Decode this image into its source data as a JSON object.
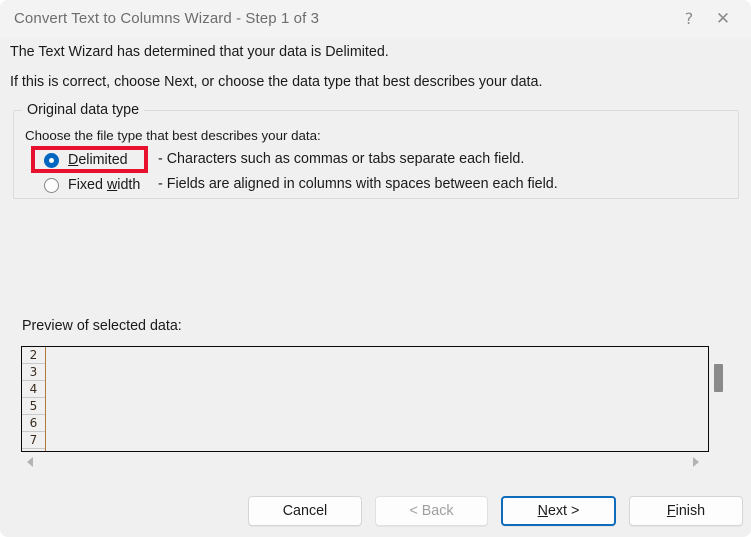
{
  "window": {
    "title": "Convert Text to Columns Wizard - Step 1 of 3",
    "help_glyph": "?",
    "close_glyph": "✕"
  },
  "intro": {
    "line1": "The Text Wizard has determined that your data is Delimited.",
    "line2": "If this is correct, choose Next, or choose the data type that best describes your data."
  },
  "original_data_type": {
    "legend": "Original data type",
    "instruction": "Choose the file type that best describes your data:",
    "options": [
      {
        "label_before": "",
        "accel": "D",
        "label_after": "elimited",
        "description": "- Characters such as commas or tabs separate each field.",
        "selected": true
      },
      {
        "label_before": "Fixed ",
        "accel": "w",
        "label_after": "idth",
        "description": "- Fields are aligned in columns with spaces between each field.",
        "selected": false
      }
    ],
    "highlight_color": "#e8112d"
  },
  "preview": {
    "label": "Preview of selected data:",
    "row_numbers": [
      "2",
      "3",
      "4",
      "5",
      "6",
      "7"
    ],
    "rows_content": [
      "",
      "",
      "",
      "",
      "",
      ""
    ],
    "hscroll_left_glyph": "left-arrow",
    "hscroll_right_glyph": "right-arrow"
  },
  "buttons": {
    "cancel": {
      "label": "Cancel",
      "enabled": true,
      "default": false
    },
    "back": {
      "label": "< Back",
      "enabled": false,
      "default": false
    },
    "next": {
      "label_before": "",
      "accel": "N",
      "label_after": "ext >",
      "enabled": true,
      "default": true
    },
    "finish": {
      "label_before": "",
      "accel": "F",
      "label_after": "inish",
      "enabled": true,
      "default": false
    }
  },
  "colors": {
    "accent": "#0067c0",
    "default_button_border": "#0f6cbd",
    "dialog_bg": "#f0f0f0",
    "titlebar_bg": "#f3f3f3"
  }
}
